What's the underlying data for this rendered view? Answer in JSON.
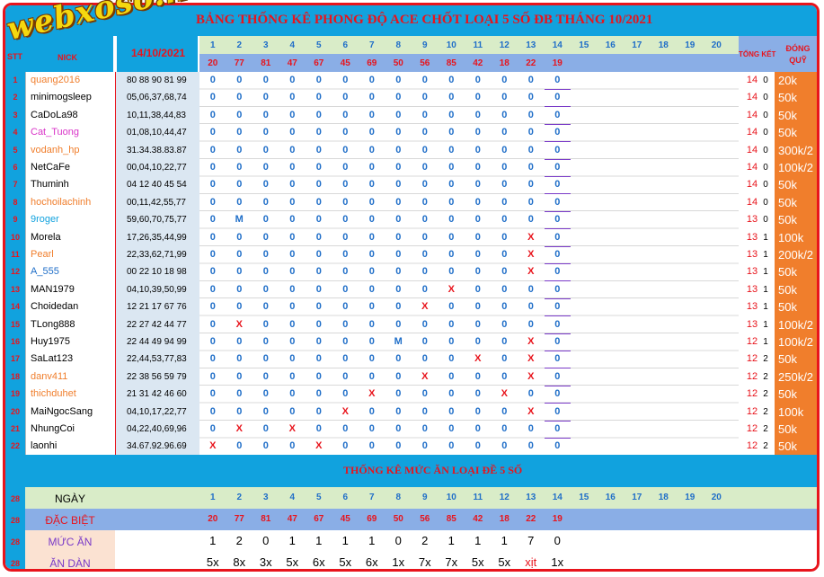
{
  "title": "BẢNG THỐNG KÊ PHONG ĐỘ ACE CHỐT LOẠI 5 SỐ ĐB THÁNG 10/2021",
  "logo": "webxoso.net",
  "header": {
    "stt": "STT",
    "nick": "NICK",
    "date": "14/10/2021",
    "tong_ket": "TỔNG KẾT",
    "dong_quy": "ĐÓNG QUỸ"
  },
  "days": [
    "1",
    "2",
    "3",
    "4",
    "5",
    "6",
    "7",
    "8",
    "9",
    "10",
    "11",
    "12",
    "13",
    "14",
    "15",
    "16",
    "17",
    "18",
    "19",
    "20"
  ],
  "results": [
    "20",
    "77",
    "81",
    "47",
    "67",
    "45",
    "69",
    "50",
    "56",
    "85",
    "42",
    "18",
    "22",
    "19",
    "",
    "",
    "",
    "",
    "",
    ""
  ],
  "players": [
    {
      "stt": "1",
      "nick": "quang2016",
      "color": "#f07e2c",
      "nums": "80 88 90 81 99",
      "res": [
        "0",
        "0",
        "0",
        "0",
        "0",
        "0",
        "0",
        "0",
        "0",
        "0",
        "0",
        "0",
        "0",
        "0"
      ],
      "tk": "14",
      "kq": "0",
      "dq": "20k"
    },
    {
      "stt": "2",
      "nick": "minimogsleep",
      "color": "#000000",
      "nums": "05,06,37,68,74",
      "res": [
        "0",
        "0",
        "0",
        "0",
        "0",
        "0",
        "0",
        "0",
        "0",
        "0",
        "0",
        "0",
        "0",
        "0"
      ],
      "tk": "14",
      "kq": "0",
      "dq": "50k"
    },
    {
      "stt": "3",
      "nick": "CaDoLa98",
      "color": "#000000",
      "nums": "10,11,38,44,83",
      "res": [
        "0",
        "0",
        "0",
        "0",
        "0",
        "0",
        "0",
        "0",
        "0",
        "0",
        "0",
        "0",
        "0",
        "0"
      ],
      "tk": "14",
      "kq": "0",
      "dq": "50k"
    },
    {
      "stt": "4",
      "nick": "Cat_Tuong",
      "color": "#d934c8",
      "nums": "01,08,10,44,47",
      "res": [
        "0",
        "0",
        "0",
        "0",
        "0",
        "0",
        "0",
        "0",
        "0",
        "0",
        "0",
        "0",
        "0",
        "0"
      ],
      "tk": "14",
      "kq": "0",
      "dq": "50k"
    },
    {
      "stt": "5",
      "nick": "vodanh_hp",
      "color": "#f07e2c",
      "nums": "31.34.38.83.87",
      "res": [
        "0",
        "0",
        "0",
        "0",
        "0",
        "0",
        "0",
        "0",
        "0",
        "0",
        "0",
        "0",
        "0",
        "0"
      ],
      "tk": "14",
      "kq": "0",
      "dq": "300k/2"
    },
    {
      "stt": "6",
      "nick": "NetCaFe",
      "color": "#000000",
      "nums": "00,04,10,22,77",
      "res": [
        "0",
        "0",
        "0",
        "0",
        "0",
        "0",
        "0",
        "0",
        "0",
        "0",
        "0",
        "0",
        "0",
        "0"
      ],
      "tk": "14",
      "kq": "0",
      "dq": "100k/2"
    },
    {
      "stt": "7",
      "nick": "Thuminh",
      "color": "#000000",
      "nums": "04 12 40 45 54",
      "res": [
        "0",
        "0",
        "0",
        "0",
        "0",
        "0",
        "0",
        "0",
        "0",
        "0",
        "0",
        "0",
        "0",
        "0"
      ],
      "tk": "14",
      "kq": "0",
      "dq": "50k"
    },
    {
      "stt": "8",
      "nick": "hochoilachinh",
      "color": "#f07e2c",
      "nums": "00,11,42,55,77",
      "res": [
        "0",
        "0",
        "0",
        "0",
        "0",
        "0",
        "0",
        "0",
        "0",
        "0",
        "0",
        "0",
        "0",
        "0"
      ],
      "tk": "14",
      "kq": "0",
      "dq": "50k"
    },
    {
      "stt": "9",
      "nick": "9roger",
      "color": "#11a2de",
      "nums": "59,60,70,75,77",
      "res": [
        "0",
        "M",
        "0",
        "0",
        "0",
        "0",
        "0",
        "0",
        "0",
        "0",
        "0",
        "0",
        "0",
        "0"
      ],
      "tk": "13",
      "kq": "0",
      "dq": "50k"
    },
    {
      "stt": "10",
      "nick": "Morela",
      "color": "#000000",
      "nums": "17,26,35,44,99",
      "res": [
        "0",
        "0",
        "0",
        "0",
        "0",
        "0",
        "0",
        "0",
        "0",
        "0",
        "0",
        "0",
        "X",
        "0"
      ],
      "tk": "13",
      "kq": "1",
      "dq": "100k"
    },
    {
      "stt": "11",
      "nick": "Pearl",
      "color": "#f07e2c",
      "nums": "22,33,62,71,99",
      "res": [
        "0",
        "0",
        "0",
        "0",
        "0",
        "0",
        "0",
        "0",
        "0",
        "0",
        "0",
        "0",
        "X",
        "0"
      ],
      "tk": "13",
      "kq": "1",
      "dq": "200k/2"
    },
    {
      "stt": "12",
      "nick": "A_555",
      "color": "#1f6ec8",
      "nums": "00 22 10 18 98",
      "res": [
        "0",
        "0",
        "0",
        "0",
        "0",
        "0",
        "0",
        "0",
        "0",
        "0",
        "0",
        "0",
        "X",
        "0"
      ],
      "tk": "13",
      "kq": "1",
      "dq": "50k"
    },
    {
      "stt": "13",
      "nick": "MAN1979",
      "color": "#000000",
      "nums": "04,10,39,50,99",
      "res": [
        "0",
        "0",
        "0",
        "0",
        "0",
        "0",
        "0",
        "0",
        "0",
        "X",
        "0",
        "0",
        "0",
        "0"
      ],
      "tk": "13",
      "kq": "1",
      "dq": "50k"
    },
    {
      "stt": "14",
      "nick": "Choidedan",
      "color": "#000000",
      "nums": "12 21 17 67 76",
      "res": [
        "0",
        "0",
        "0",
        "0",
        "0",
        "0",
        "0",
        "0",
        "X",
        "0",
        "0",
        "0",
        "0",
        "0"
      ],
      "tk": "13",
      "kq": "1",
      "dq": "50k"
    },
    {
      "stt": "15",
      "nick": "TLong888",
      "color": "#000000",
      "nums": "22 27 42 44 77",
      "res": [
        "0",
        "X",
        "0",
        "0",
        "0",
        "0",
        "0",
        "0",
        "0",
        "0",
        "0",
        "0",
        "0",
        "0"
      ],
      "tk": "13",
      "kq": "1",
      "dq": "100k/2"
    },
    {
      "stt": "16",
      "nick": "Huy1975",
      "color": "#000000",
      "nums": "22 44 49 94 99",
      "res": [
        "0",
        "0",
        "0",
        "0",
        "0",
        "0",
        "0",
        "M",
        "0",
        "0",
        "0",
        "0",
        "X",
        "0"
      ],
      "tk": "12",
      "kq": "1",
      "dq": "100k/2"
    },
    {
      "stt": "17",
      "nick": "SaLat123",
      "color": "#000000",
      "nums": "22,44,53,77,83",
      "res": [
        "0",
        "0",
        "0",
        "0",
        "0",
        "0",
        "0",
        "0",
        "0",
        "0",
        "X",
        "0",
        "X",
        "0"
      ],
      "tk": "12",
      "kq": "2",
      "dq": "50k"
    },
    {
      "stt": "18",
      "nick": "danv411",
      "color": "#f07e2c",
      "nums": "22 38 56 59 79",
      "res": [
        "0",
        "0",
        "0",
        "0",
        "0",
        "0",
        "0",
        "0",
        "X",
        "0",
        "0",
        "0",
        "X",
        "0"
      ],
      "tk": "12",
      "kq": "2",
      "dq": "250k/2"
    },
    {
      "stt": "19",
      "nick": "thichduhet",
      "color": "#f07e2c",
      "nums": "21 31 42 46 60",
      "res": [
        "0",
        "0",
        "0",
        "0",
        "0",
        "0",
        "X",
        "0",
        "0",
        "0",
        "0",
        "X",
        "0",
        "0"
      ],
      "tk": "12",
      "kq": "2",
      "dq": "50k"
    },
    {
      "stt": "20",
      "nick": "MaiNgocSang",
      "color": "#000000",
      "nums": "04,10,17,22,77",
      "res": [
        "0",
        "0",
        "0",
        "0",
        "0",
        "X",
        "0",
        "0",
        "0",
        "0",
        "0",
        "0",
        "X",
        "0"
      ],
      "tk": "12",
      "kq": "2",
      "dq": "100k"
    },
    {
      "stt": "21",
      "nick": "NhungCoi",
      "color": "#000000",
      "nums": "04,22,40,69,96",
      "res": [
        "0",
        "X",
        "0",
        "X",
        "0",
        "0",
        "0",
        "0",
        "0",
        "0",
        "0",
        "0",
        "0",
        "0"
      ],
      "tk": "12",
      "kq": "2",
      "dq": "50k"
    },
    {
      "stt": "22",
      "nick": "laonhi",
      "color": "#000000",
      "nums": "34.67.92.96.69",
      "res": [
        "X",
        "0",
        "0",
        "0",
        "X",
        "0",
        "0",
        "0",
        "0",
        "0",
        "0",
        "0",
        "0",
        "0"
      ],
      "tk": "12",
      "kq": "2",
      "dq": "50k"
    }
  ],
  "summary": {
    "title": "THỐNG KÊ MỨC ĂN LOẠI ĐỀ 5 SỐ",
    "rows": [
      {
        "stt": "28",
        "label": "NGÀY",
        "label_color": "#000000",
        "bg": "#d9ecc8",
        "label_bg": "#d9ecc8",
        "cell_color": "#1f6ec8",
        "bold": true,
        "cells": [
          "1",
          "2",
          "3",
          "4",
          "5",
          "6",
          "7",
          "8",
          "9",
          "10",
          "11",
          "12",
          "13",
          "14",
          "15",
          "16",
          "17",
          "18",
          "19",
          "20"
        ]
      },
      {
        "stt": "28",
        "label": "ĐẶC BIỆT",
        "label_color": "#e8141c",
        "bg": "#8aaee6",
        "label_bg": "#8aaee6",
        "cell_color": "#e8141c",
        "bold": true,
        "cells": [
          "20",
          "77",
          "81",
          "47",
          "67",
          "45",
          "69",
          "50",
          "56",
          "85",
          "42",
          "18",
          "22",
          "19",
          "",
          "",
          "",
          "",
          "",
          ""
        ]
      },
      {
        "stt": "28",
        "label": "MỨC ĂN",
        "label_color": "#7a3ac8",
        "bg": "#ffffff",
        "label_bg": "#fbe2d2",
        "cell_color": "#000000",
        "bold": false,
        "cells": [
          "1",
          "2",
          "0",
          "1",
          "1",
          "1",
          "1",
          "0",
          "2",
          "1",
          "1",
          "1",
          "7",
          "0",
          "",
          "",
          "",
          "",
          "",
          ""
        ]
      },
      {
        "stt": "28",
        "label": "ĂN DÀN",
        "label_color": "#7a3ac8",
        "bg": "#ffffff",
        "label_bg": "#fbe2d2",
        "cell_color": "#000000",
        "bold": false,
        "cells": [
          "5x",
          "8x",
          "3x",
          "5x",
          "6x",
          "5x",
          "6x",
          "1x",
          "7x",
          "7x",
          "5x",
          "5x",
          "xịt",
          "1x",
          "",
          "",
          "",
          "",
          "",
          ""
        ]
      }
    ]
  },
  "colors": {
    "accent_blue": "#11a2de",
    "red": "#e8141c",
    "orange": "#f07e2c",
    "result_blue": "#1f6ec8"
  }
}
